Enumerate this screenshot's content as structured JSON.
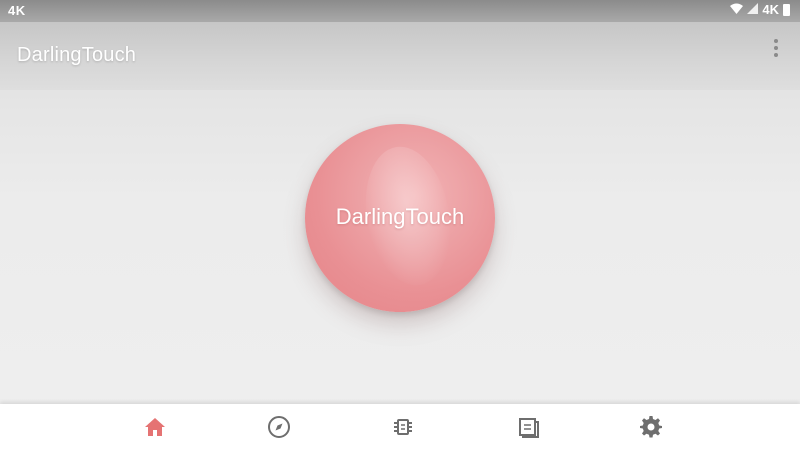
{
  "status_bar": {
    "left_text": "4K",
    "right_text": "4K"
  },
  "app_bar": {
    "title": "DarlingTouch",
    "overflow_icon": "more-vert-icon"
  },
  "main": {
    "touch_button_label": "DarlingTouch",
    "touch_button_color": "#e99094"
  },
  "bottom_nav": {
    "items": [
      {
        "icon": "home-icon",
        "active": true
      },
      {
        "icon": "compass-icon",
        "active": false
      },
      {
        "icon": "chip-icon",
        "active": false
      },
      {
        "icon": "journal-icon",
        "active": false
      },
      {
        "icon": "gear-icon",
        "active": false
      }
    ],
    "active_color": "#e57373",
    "inactive_color": "#6e6e6e"
  }
}
